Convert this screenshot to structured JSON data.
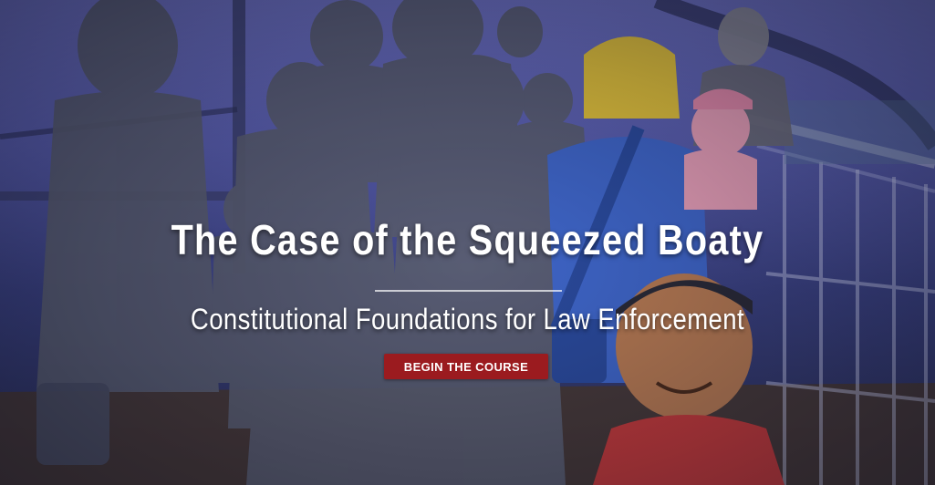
{
  "hero": {
    "title": "The Case of the Squeezed Boaty",
    "subtitle": "Constitutional Foundations for Law Enforcement",
    "cta_label": "BEGIN THE COURSE"
  },
  "colors": {
    "sky": "#6f73c6",
    "cta_background": "#9b1b1f",
    "text": "#ffffff",
    "blonde_hair": "#e6c53a",
    "blue_shirt": "#3f66c9",
    "baby_pink": "#e9a0b8",
    "child_skin": "#b77a52"
  },
  "illustration": {
    "icon": "ferry-crowd-illustration"
  }
}
